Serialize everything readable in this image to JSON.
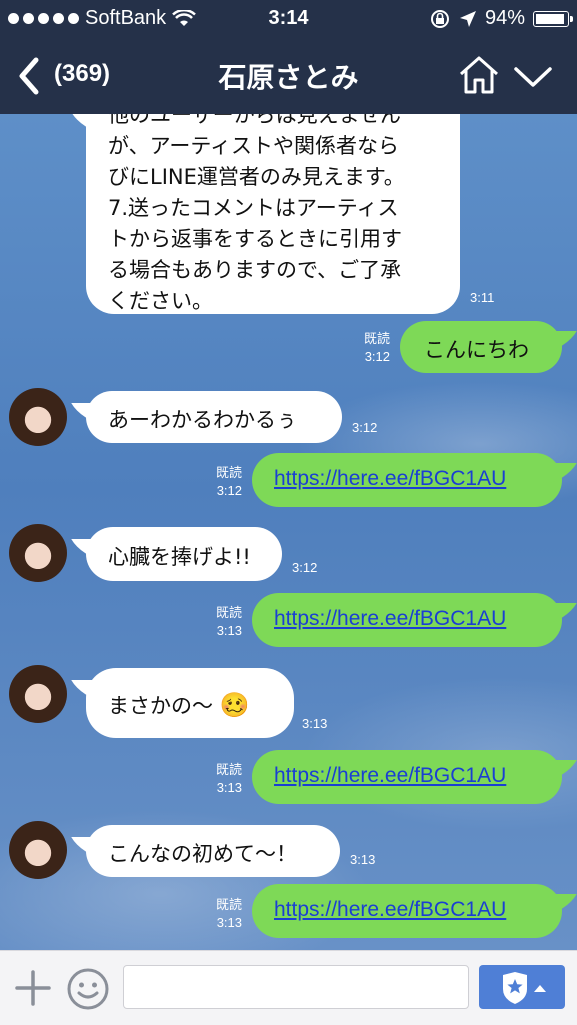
{
  "status": {
    "carrier": "SoftBank",
    "time": "3:14",
    "battery": "94%",
    "battery_level": 0.94
  },
  "nav": {
    "back_count": "(369)",
    "title": "石原さとみ"
  },
  "messages": {
    "m0": {
      "lines": [
        "他のユーザーからは見えません",
        "が、アーティストや関係者なら",
        "びにLINE運営者のみ見えます。",
        "7.送ったコメントはアーティス",
        "トから返事をするときに引用す",
        "る場合もありますので、ご了承",
        "ください。"
      ],
      "time": "3:11"
    },
    "m1": {
      "text": "こんにちわ",
      "read": "既読",
      "time": "3:12"
    },
    "m2": {
      "text": "あーわかるわかるぅ",
      "time": "3:12"
    },
    "m3": {
      "link": "https://here.ee/fBGC1AU",
      "read": "既読",
      "time": "3:12"
    },
    "m4": {
      "text": "心臓を捧げよ!!",
      "time": "3:12"
    },
    "m5": {
      "link": "https://here.ee/fBGC1AU",
      "read": "既読",
      "time": "3:13"
    },
    "m6": {
      "text": "まさかの〜",
      "emoji": "🥴",
      "time": "3:13"
    },
    "m7": {
      "link": "https://here.ee/fBGC1AU",
      "read": "既読",
      "time": "3:13"
    },
    "m8": {
      "text": "こんなの初めて〜！",
      "time": "3:13"
    },
    "m9": {
      "link": "https://here.ee/fBGC1AU",
      "read": "既読",
      "time": "3:13"
    }
  },
  "input": {
    "placeholder": ""
  },
  "colors": {
    "nav_bg": "#253149",
    "outgoing_bubble": "#7ed957",
    "incoming_bubble": "#ffffff",
    "link": "#1a3fd3",
    "send_button": "#4f7fd6"
  }
}
